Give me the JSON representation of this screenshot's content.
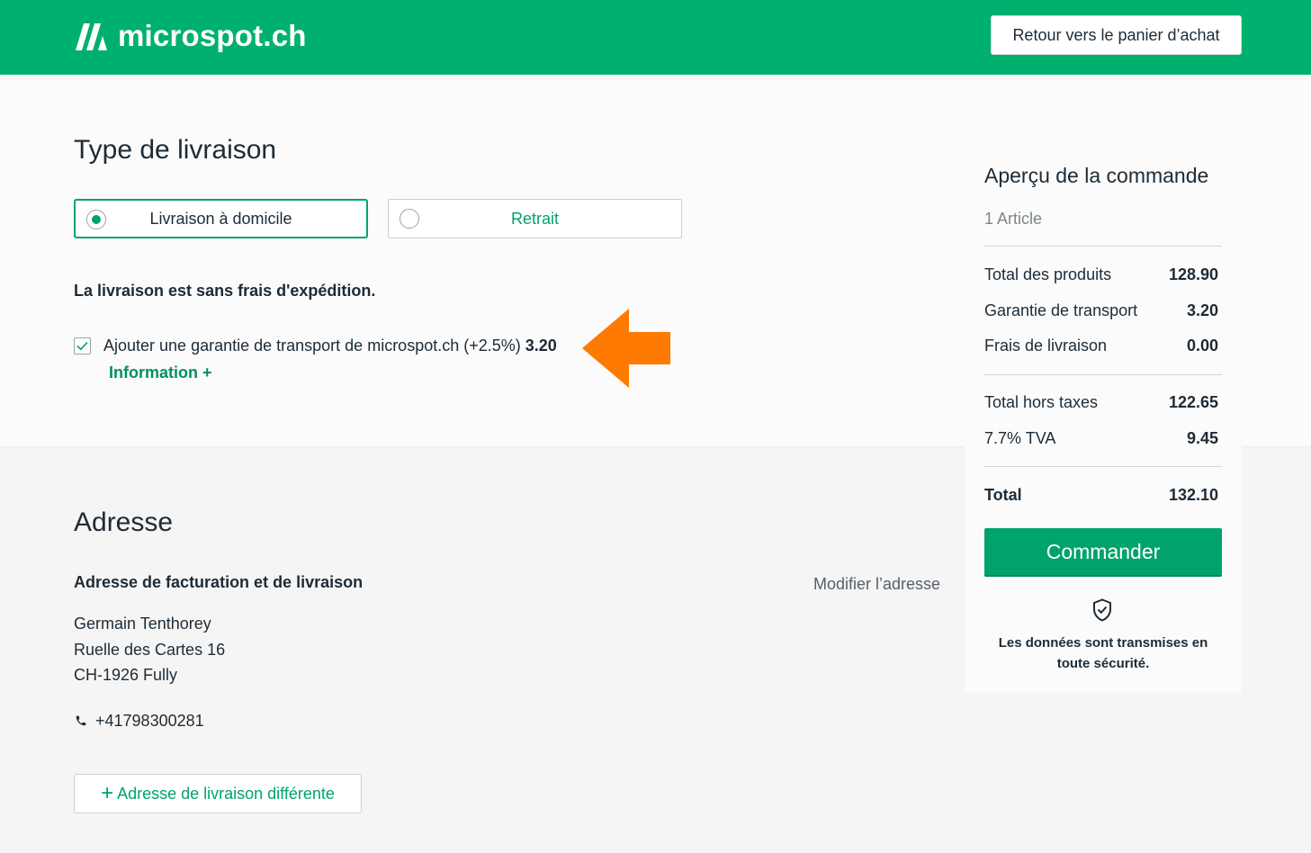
{
  "brand": {
    "name": "microspot.ch",
    "color": "#00b06e",
    "accent": "#00a36a",
    "arrow_color": "#ff7a00"
  },
  "header": {
    "back_label": "Retour vers le panier d’achat"
  },
  "delivery": {
    "title": "Type de livraison",
    "options": [
      {
        "label": "Livraison à domicile",
        "selected": true
      },
      {
        "label": "Retrait",
        "selected": false
      }
    ],
    "free_note": "La livraison est sans frais d'expédition.",
    "guarantee": {
      "text": "Ajouter une garantie de transport de microspot.ch (+2.5%)",
      "price": "3.20",
      "checked": true
    },
    "info_link": "Information +"
  },
  "address": {
    "title": "Adresse",
    "subtitle": "Adresse de facturation et de livraison",
    "modify_label": "Modifier l’adresse",
    "lines": [
      "Germain Tenthorey",
      "Ruelle des Cartes 16",
      "CH-1926 Fully"
    ],
    "phone": "+41798300281",
    "alt_label": "Adresse de livraison différente",
    "alt_plus": "+"
  },
  "summary": {
    "title": "Aperçu de la commande",
    "count": "1 Article",
    "rows": [
      {
        "label": "Total des produits",
        "value": "128.90"
      },
      {
        "label": "Garantie de transport",
        "value": "3.20"
      },
      {
        "label": "Frais de livraison",
        "value": "0.00"
      },
      {
        "label": "Total hors taxes",
        "value": "122.65"
      },
      {
        "label": "7.7% TVA",
        "value": "9.45"
      },
      {
        "label": "Total",
        "value": "132.10"
      }
    ],
    "order_button": "Commander",
    "secure_line1": "Les données sont transmises en",
    "secure_line2": "toute sécurité."
  }
}
